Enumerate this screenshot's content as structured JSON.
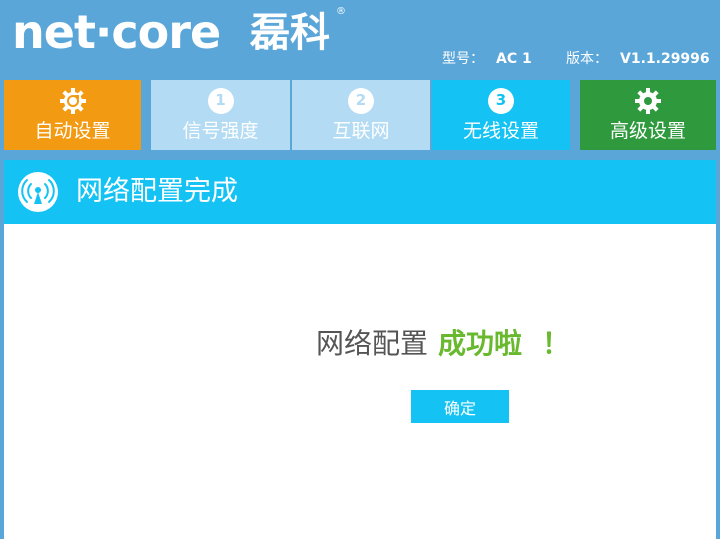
{
  "header": {
    "logo": "net·core",
    "logo_cn": "磊科",
    "registered_mark": "®",
    "model_label": "型号：",
    "model_value": "AC 1",
    "version_label": "版本：",
    "version_value": "V1.1.29996"
  },
  "nav": {
    "tabs": [
      {
        "label": "自动设置",
        "icon": "gear-refresh-icon",
        "color": "#f39a13"
      },
      {
        "label": "信号强度",
        "step": "1",
        "color": "#b3dbf3"
      },
      {
        "label": "互联网",
        "step": "2",
        "color": "#b3dbf3"
      },
      {
        "label": "无线设置",
        "step": "3",
        "color": "#14c3f3",
        "active": true
      },
      {
        "label": "高级设置",
        "icon": "gear-icon",
        "color": "#2f9a3d"
      }
    ]
  },
  "panel": {
    "title": "网络配置完成",
    "title_icon": "wifi-antenna-icon",
    "message_prefix": "网络配置",
    "message_emphasis": "成功啦",
    "message_bang": "！",
    "confirm_label": "确定"
  },
  "colors": {
    "header_bg": "#5aa6d8",
    "accent_blue": "#14c3f3",
    "success_green": "#68b92e",
    "orange": "#f39a13",
    "green": "#2f9a3d"
  }
}
